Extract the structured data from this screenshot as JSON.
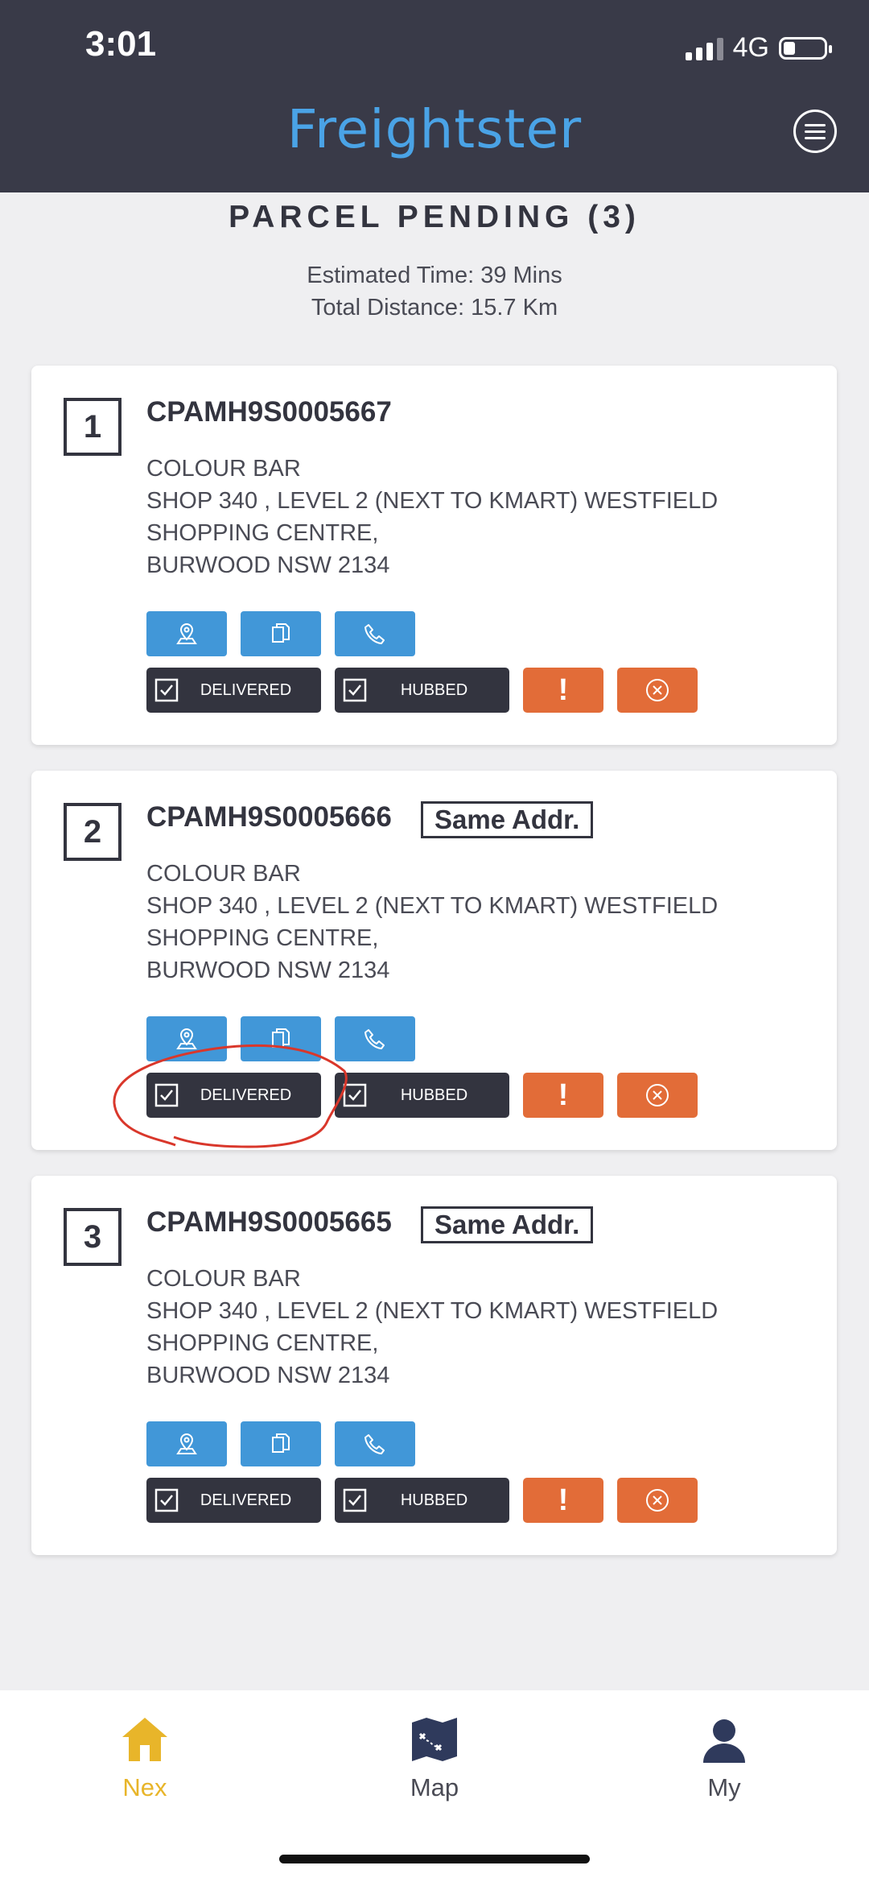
{
  "status_bar": {
    "time": "3:01",
    "network": "4G"
  },
  "header": {
    "logo": "Freightster"
  },
  "page": {
    "title": "PARCEL PENDING (3)",
    "estimated_time": "Estimated Time: 39 Mins",
    "total_distance": "Total Distance: 15.7 Km"
  },
  "parcels": [
    {
      "number": "1",
      "code": "CPAMH9S0005667",
      "same_label": "",
      "name": "COLOUR BAR",
      "address_line1": "SHOP 340 , LEVEL 2 (NEXT TO KMART) WESTFIELD",
      "address_line2": "SHOPPING CENTRE,",
      "address_line3": "BURWOOD NSW 2134",
      "delivered_label": "DELIVERED",
      "hubbed_label": "HUBBED"
    },
    {
      "number": "2",
      "code": "CPAMH9S0005666",
      "same_label": "Same Addr.",
      "name": "COLOUR BAR",
      "address_line1": "SHOP 340 , LEVEL 2 (NEXT TO KMART) WESTFIELD",
      "address_line2": "SHOPPING CENTRE,",
      "address_line3": "BURWOOD NSW 2134",
      "delivered_label": "DELIVERED",
      "hubbed_label": "HUBBED"
    },
    {
      "number": "3",
      "code": "CPAMH9S0005665",
      "same_label": "Same Addr.",
      "name": "COLOUR BAR",
      "address_line1": "SHOP 340 , LEVEL 2 (NEXT TO KMART) WESTFIELD",
      "address_line2": "SHOPPING CENTRE,",
      "address_line3": "BURWOOD NSW 2134",
      "delivered_label": "DELIVERED",
      "hubbed_label": "HUBBED"
    }
  ],
  "bottom_nav": [
    {
      "label": "Nex",
      "icon": "home-icon",
      "active": true
    },
    {
      "label": "Map",
      "icon": "map-icon",
      "active": false
    },
    {
      "label": "My",
      "icon": "user-icon",
      "active": false
    }
  ],
  "colors": {
    "header_bg": "#393a48",
    "brand_blue": "#4197d8",
    "action_dark": "#33343f",
    "alert_orange": "#e26c38",
    "nav_active": "#e8b52a",
    "annotation_red": "#d9372b"
  }
}
